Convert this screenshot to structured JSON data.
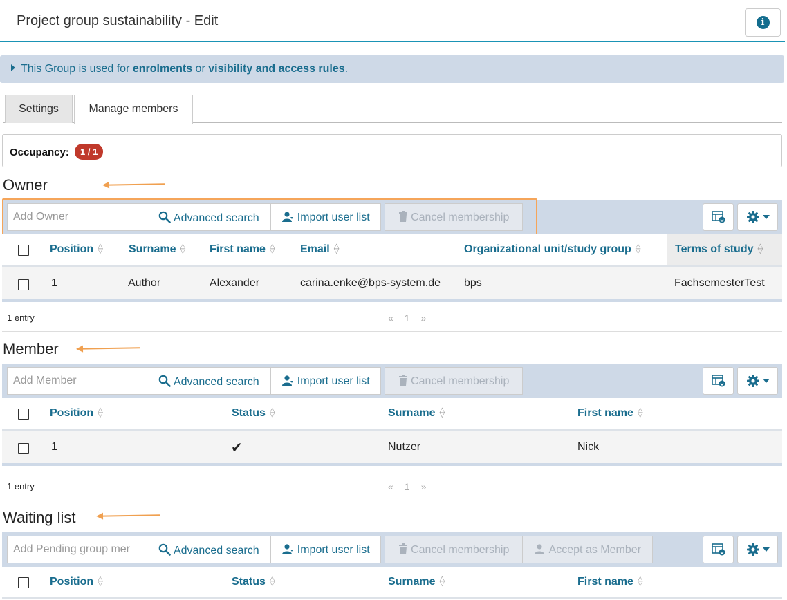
{
  "header": {
    "title": "Project group sustainability - Edit",
    "info_icon": "info-icon"
  },
  "notice": {
    "prefix": "This Group is used for ",
    "link1": "enrolments",
    "middle": " or ",
    "link2": "visibility and access rules",
    "suffix": "."
  },
  "tabs": [
    {
      "label": "Settings"
    },
    {
      "label": "Manage members"
    }
  ],
  "occupancy": {
    "label": "Occupancy:",
    "value": "1 / 1",
    "color": "#c0392b"
  },
  "colors": {
    "accent": "#1a6d8e",
    "toolbar_bg": "#ced9e7",
    "highlight": "#f5a55a"
  },
  "toolbar": {
    "advanced_search": "Advanced search",
    "import_user_list": "Import user list",
    "cancel_membership": "Cancel membership",
    "accept_as_member": "Accept as Member"
  },
  "owner": {
    "title": "Owner",
    "input_placeholder": "Add Owner",
    "columns": [
      "Position",
      "Surname",
      "First name",
      "Email",
      "Organizational unit/study group",
      "Terms of study"
    ],
    "rows": [
      {
        "position": "1",
        "surname": "Author",
        "first_name": "Alexander",
        "email": "carina.enke@bps-system.de",
        "org_unit": "bps",
        "terms": "FachsemesterTest"
      }
    ],
    "entries": "1 entry",
    "pager": {
      "prev": "«",
      "page": "1",
      "next": "»"
    }
  },
  "member": {
    "title": "Member",
    "input_placeholder": "Add Member",
    "columns": [
      "Position",
      "Status",
      "Surname",
      "First name"
    ],
    "rows": [
      {
        "position": "1",
        "status": "✔",
        "surname": "Nutzer",
        "first_name": "Nick"
      }
    ],
    "entries": "1 entry",
    "pager": {
      "prev": "«",
      "page": "1",
      "next": "»"
    }
  },
  "waiting": {
    "title": "Waiting list",
    "input_placeholder": "Add Pending group mer",
    "columns": [
      "Position",
      "Status",
      "Surname",
      "First name"
    ]
  }
}
